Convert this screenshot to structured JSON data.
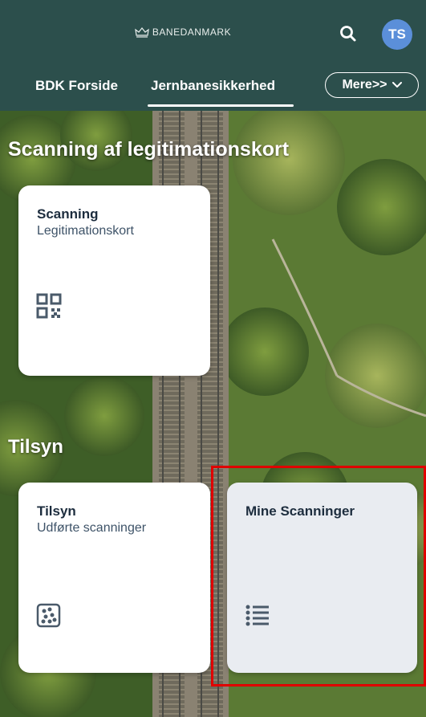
{
  "header": {
    "brand": "BANEDANMARK",
    "avatar_initials": "TS",
    "tabs": [
      {
        "label": "BDK Forside",
        "active": false
      },
      {
        "label": "Jernbanesikkerhed",
        "active": true
      }
    ],
    "more_label": "Mere>>",
    "bg_color": "#2c4f4c",
    "avatar_color": "#5b8fd9"
  },
  "sections": {
    "scanning_title": "Scanning af legitimationskort",
    "tilsyn_title": "Tilsyn"
  },
  "tiles": {
    "scanning": {
      "title": "Scanning",
      "subtitle": "Legitimationskort",
      "icon": "qr-code-icon"
    },
    "tilsyn": {
      "title": "Tilsyn",
      "subtitle": "Udførte scanninger",
      "icon": "scatter-chart-icon"
    },
    "mine_scanninger": {
      "title": "Mine Scanninger",
      "icon": "list-icon"
    }
  },
  "highlight_color": "#e00000"
}
